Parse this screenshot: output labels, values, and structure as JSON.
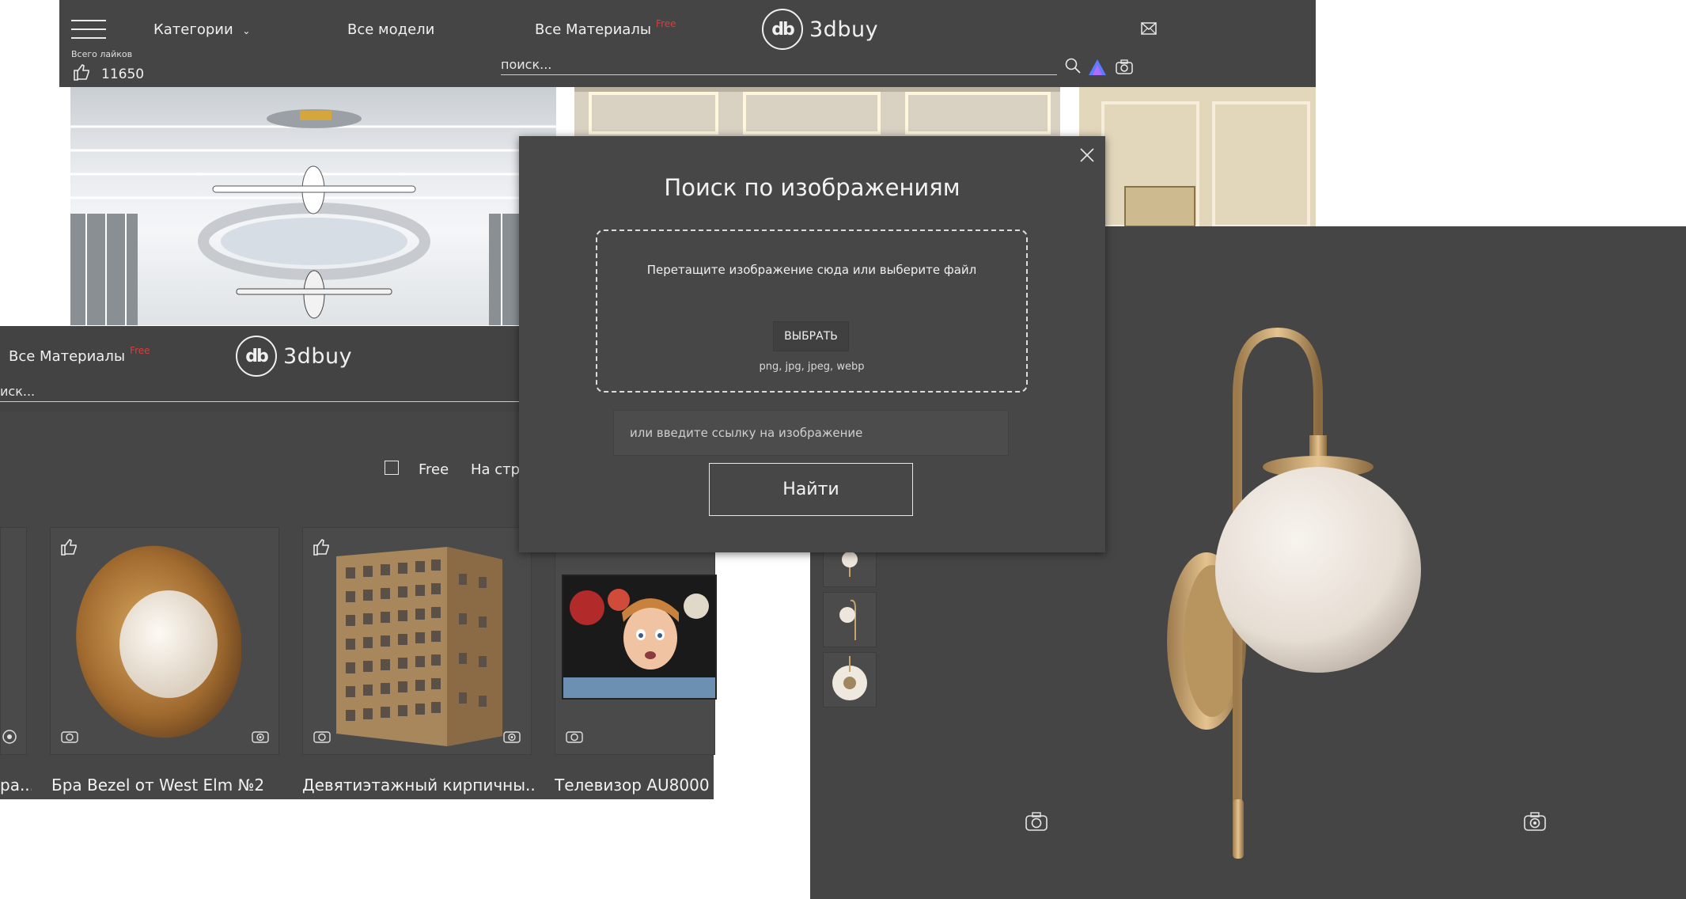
{
  "screen1": {
    "categories_label": "Категории",
    "all_models_label": "Все модели",
    "all_materials_label": "Все Материалы",
    "free_tag": "Free",
    "logo_mark": "db",
    "logo_text": "3dbuy",
    "likes_caption": "Всего лайков",
    "likes_count": "11650",
    "search_placeholder": "поиск..."
  },
  "screen2": {
    "all_materials_label": "Все Материалы",
    "free_tag": "Free",
    "logo_mark": "db",
    "logo_text": "3dbuy",
    "search_placeholder": "иск...",
    "filter_free_label": "Free",
    "filter_page_label": "На стр",
    "cards": [
      {
        "title": "ра..."
      },
      {
        "title": "Бра Bezel от West Elm №2"
      },
      {
        "title": "Девятиэтажный кирпичны..."
      },
      {
        "title": "Телевизор AU8000"
      }
    ]
  },
  "modal": {
    "title": "Поиск по изображениям",
    "drop_text": "Перетащите изображение сюда или выберите файл",
    "choose_button": "ВЫБРАТЬ",
    "formats": "png, jpg, jpeg, webp",
    "url_placeholder": "или введите ссылку на изображение",
    "find_button": "Найти"
  },
  "colors": {
    "panel": "#454545",
    "accent_red": "#e03a3a",
    "text": "#f0f0f0"
  }
}
